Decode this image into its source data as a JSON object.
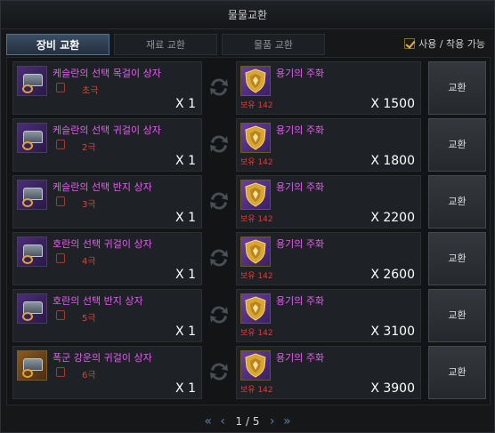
{
  "window": {
    "title": "물물교환"
  },
  "tabs": [
    {
      "label": "장비 교환",
      "active": true
    },
    {
      "label": "재료 교환",
      "active": false
    },
    {
      "label": "물품 교환",
      "active": false
    }
  ],
  "filter": {
    "label": "사용 / 착용 가능",
    "checked": true
  },
  "rows": [
    {
      "item_name": "케슬란의 선택 목걸이 상자",
      "tier": "초극",
      "qty": "X 1",
      "target_name": "용기의 주화",
      "owned": "보유 142",
      "cost": "X 1500",
      "button": "교환",
      "icon": "chest-necklace-icon",
      "icon_style": "purple"
    },
    {
      "item_name": "케슬란의 선택 귀걸이 상자",
      "tier": "2극",
      "qty": "X 1",
      "target_name": "용기의 주화",
      "owned": "보유 142",
      "cost": "X 1800",
      "button": "교환",
      "icon": "chest-earring-icon",
      "icon_style": "purple"
    },
    {
      "item_name": "케슬란의 선택 반지 상자",
      "tier": "3극",
      "qty": "X 1",
      "target_name": "용기의 주화",
      "owned": "보유 142",
      "cost": "X 2200",
      "button": "교환",
      "icon": "chest-ring-icon",
      "icon_style": "purple"
    },
    {
      "item_name": "호란의 선택 귀걸이 상자",
      "tier": "4극",
      "qty": "X 1",
      "target_name": "용기의 주화",
      "owned": "보유 142",
      "cost": "X 2600",
      "button": "교환",
      "icon": "chest-earring-icon",
      "icon_style": "purple"
    },
    {
      "item_name": "호란의 선택 반지 상자",
      "tier": "5극",
      "qty": "X 1",
      "target_name": "용기의 주화",
      "owned": "보유 142",
      "cost": "X 3100",
      "button": "교환",
      "icon": "chest-ring-icon",
      "icon_style": "purple"
    },
    {
      "item_name": "폭군 강운의 귀걸이 상자",
      "tier": "6극",
      "qty": "X 1",
      "target_name": "용기의 주화",
      "owned": "보유 142",
      "cost": "X 3900",
      "button": "교환",
      "icon": "chest-earring-icon",
      "icon_style": "orange"
    }
  ],
  "pagination": {
    "current": "1 / 5"
  },
  "colors": {
    "accent": "#5b7fa8",
    "item_name": "#e45cf0",
    "owned": "#e33a3a",
    "tier": "#d0483a"
  }
}
